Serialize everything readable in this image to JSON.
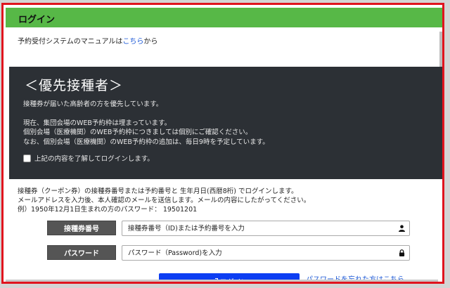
{
  "header": {
    "title": "ログイン"
  },
  "manual": {
    "prefix": "予約受付システムのマニュアルは",
    "link": "こちら",
    "suffix": "から"
  },
  "notice": {
    "title": "＜優先接種者＞",
    "lines": [
      "接種券が届いた高齢者の方を優先しています。",
      "現在、集団会場のWEB予約枠は埋まっています。",
      "個別会場（医療機関）のWEB予約枠につきましては個別にご確認ください。",
      "なお、個別会場（医療機関）のWEB予約枠の追加は、毎日9時を予定しています。"
    ],
    "agree_label": "上記の内容を了解してログインします。"
  },
  "instructions": [
    "接種券（クーポン券）の接種券番号または予約番号と 生年月日(西暦8桁) でログインします。",
    "メールアドレスを入力後、本人確認のメールを送信します。メールの内容にしたがってください。",
    "例）1950年12月1日生まれの方のパスワード： 19501201"
  ],
  "form": {
    "id_label": "接種券番号",
    "id_placeholder": "接種券番号（ID)または予約番号を入力",
    "id_icon": "user-icon",
    "password_label": "パスワード",
    "password_placeholder": "パスワード（Password)を入力",
    "password_icon": "lock-icon",
    "login_button": "ログイン",
    "login_icon": "sign-in-icon",
    "forgot_link": "パスワードを忘れた方はこちら"
  },
  "colors": {
    "header": "#57b847",
    "panel": "#2c3035",
    "button": "#0d3ef2",
    "link": "#1a57d6",
    "frame": "#e0141e"
  }
}
